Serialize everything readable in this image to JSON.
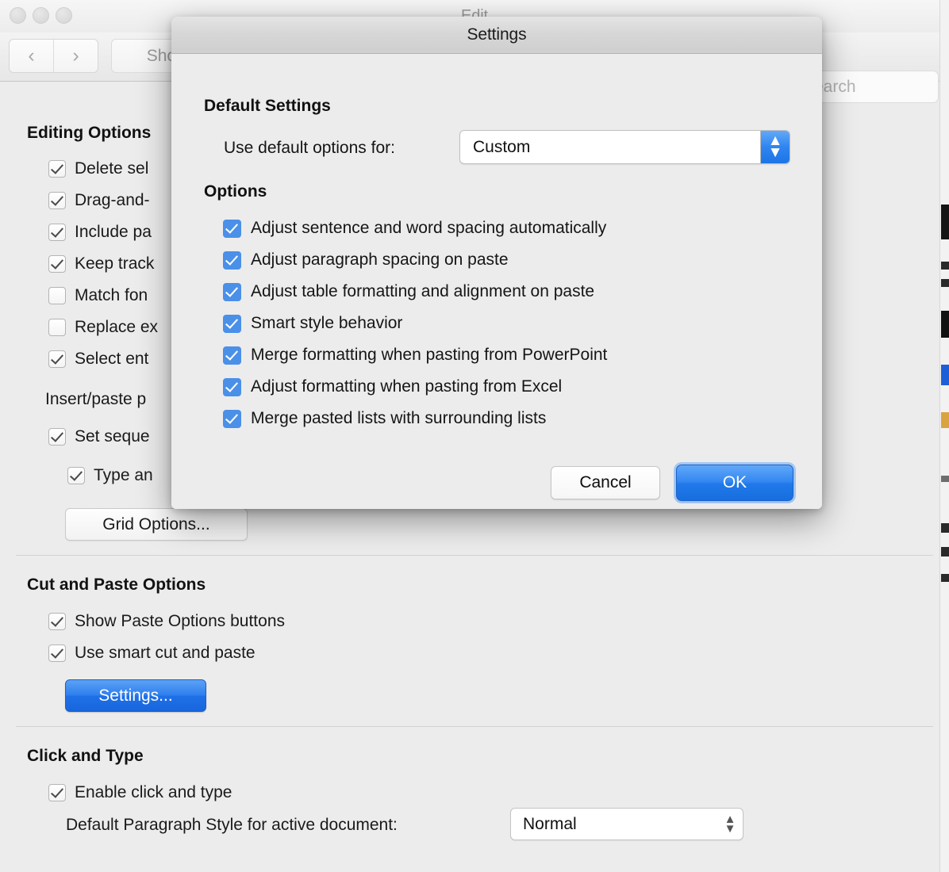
{
  "background_window": {
    "title": "Edit",
    "traffic_lights": [
      "close",
      "minimize",
      "zoom"
    ],
    "nav_back": "‹",
    "nav_forward": "›",
    "show_all_label": "Show All",
    "search_placeholder": "Search",
    "sections": [
      {
        "heading": "Editing Options",
        "rows": [
          {
            "label": "Delete sel",
            "checked": true
          },
          {
            "label": "Drag-and-",
            "checked": true
          },
          {
            "label": "Include pa",
            "checked": true
          },
          {
            "label": "Keep track",
            "checked": true
          },
          {
            "label": "Match fon",
            "checked": false
          },
          {
            "label": "Replace ex",
            "checked": false
          },
          {
            "label": "Select ent",
            "checked": true
          }
        ],
        "subgroup_label": "Insert/paste p",
        "subgroup_rows": [
          {
            "label": "Set seque",
            "checked": true,
            "indent": 0
          },
          {
            "label": "Type an",
            "checked": true,
            "indent": 1
          }
        ],
        "button": "Grid Options..."
      },
      {
        "heading": "Cut and Paste Options",
        "rows": [
          {
            "label": "Show Paste Options buttons",
            "checked": true
          },
          {
            "label": "Use smart cut and paste",
            "checked": true
          }
        ],
        "button": "Settings..."
      },
      {
        "heading": "Click and Type",
        "rows": [
          {
            "label": "Enable click and type",
            "checked": true
          }
        ],
        "paragraph_style_label": "Default Paragraph Style for active document:",
        "paragraph_style_value": "Normal"
      }
    ]
  },
  "dialog": {
    "title": "Settings",
    "default_settings": {
      "heading": "Default Settings",
      "label": "Use default options for:",
      "value": "Custom"
    },
    "options": {
      "heading": "Options",
      "items": [
        {
          "label": "Adjust sentence and word spacing automatically",
          "checked": true
        },
        {
          "label": "Adjust paragraph spacing on paste",
          "checked": true
        },
        {
          "label": "Adjust table formatting and alignment on paste",
          "checked": true
        },
        {
          "label": "Smart style behavior",
          "checked": true
        },
        {
          "label": "Merge formatting when pasting from PowerPoint",
          "checked": true
        },
        {
          "label": "Adjust formatting when pasting from Excel",
          "checked": true
        },
        {
          "label": "Merge pasted lists with surrounding lists",
          "checked": true
        }
      ]
    },
    "buttons": {
      "cancel": "Cancel",
      "ok": "OK"
    }
  },
  "colors": {
    "accent_blue": "#2f85f0",
    "checkbox_blue": "#4a90e8",
    "window_bg": "#ececec",
    "dialog_bg": "#ececec"
  }
}
